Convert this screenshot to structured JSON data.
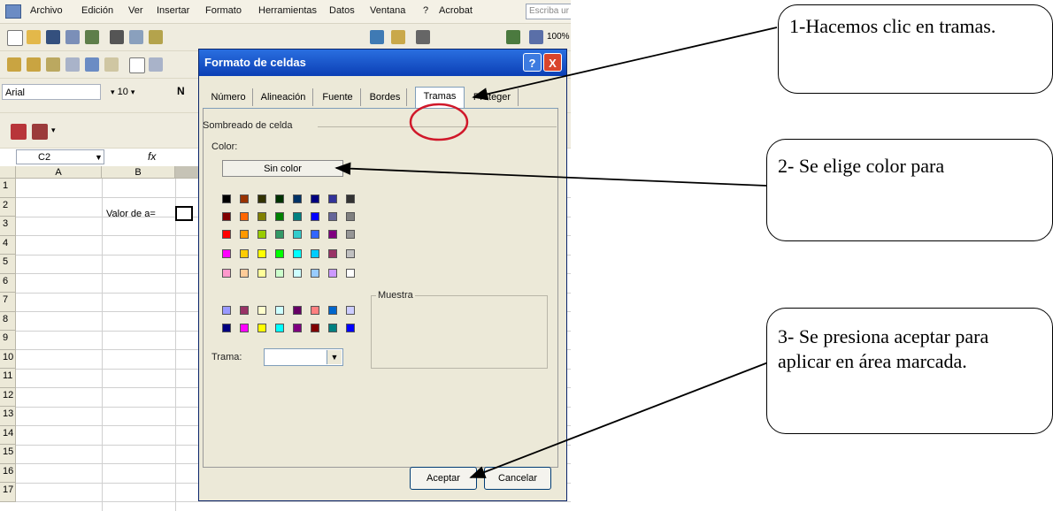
{
  "menu": {
    "items": [
      "Archivo",
      "Edición",
      "Ver",
      "Insertar",
      "Formato",
      "Herramientas",
      "Datos",
      "Ventana",
      "?",
      "Acrobat"
    ],
    "ask_placeholder": "Escriba ur"
  },
  "format_toolbar": {
    "font": "Arial",
    "size": "10",
    "bold": "N"
  },
  "toolbar_zoom": "100%",
  "formula_bar": {
    "cell_ref": "C2",
    "fx": "fx"
  },
  "sheet": {
    "columns": [
      "A",
      "B"
    ],
    "rows": [
      "1",
      "2",
      "3",
      "4",
      "5",
      "6",
      "7",
      "8",
      "9",
      "10",
      "11",
      "12",
      "13",
      "14",
      "15",
      "16",
      "17"
    ],
    "b2": "Valor de a="
  },
  "dialog": {
    "title": "Formato de celdas",
    "title_buttons": {
      "help": "?",
      "close": "X"
    },
    "tabs": [
      "Número",
      "Alineación",
      "Fuente",
      "Bordes",
      "Tramas",
      "Proteger"
    ],
    "active_tab": "Tramas",
    "section_label": "Sombreado de celda",
    "color_label": "Color:",
    "no_color_button": "Sin color",
    "sample_label": "Muestra",
    "pattern_label": "Trama:",
    "ok_button": "Aceptar",
    "cancel_button": "Cancelar",
    "palette_rows": [
      [
        "#000000",
        "#993300",
        "#333300",
        "#003300",
        "#003366",
        "#000080",
        "#333399",
        "#333333"
      ],
      [
        "#800000",
        "#FF6600",
        "#808000",
        "#008000",
        "#008080",
        "#0000FF",
        "#666699",
        "#808080"
      ],
      [
        "#FF0000",
        "#FF9900",
        "#99CC00",
        "#339966",
        "#33CCCC",
        "#3366FF",
        "#800080",
        "#969696"
      ],
      [
        "#FF00FF",
        "#FFCC00",
        "#FFFF00",
        "#00FF00",
        "#00FFFF",
        "#00CCFF",
        "#993366",
        "#C0C0C0"
      ],
      [
        "#FF99CC",
        "#FFCC99",
        "#FFFF99",
        "#CCFFCC",
        "#CCFFFF",
        "#99CCFF",
        "#CC99FF",
        "#FFFFFF"
      ],
      [
        "#9999FF",
        "#993366",
        "#FFFFCC",
        "#CCFFFF",
        "#660066",
        "#FF8080",
        "#0066CC",
        "#CCCCFF"
      ],
      [
        "#000080",
        "#FF00FF",
        "#FFFF00",
        "#00FFFF",
        "#800080",
        "#800000",
        "#008080",
        "#0000FF"
      ]
    ]
  },
  "callouts": {
    "c1": "1-Hacemos clic en tramas.",
    "c2": "2- Se elige color para",
    "c3": "3- Se presiona aceptar para aplicar en área marcada."
  },
  "colors": {
    "title_bar": "#0b3fb5",
    "highlight_circle": "#d0182a"
  }
}
